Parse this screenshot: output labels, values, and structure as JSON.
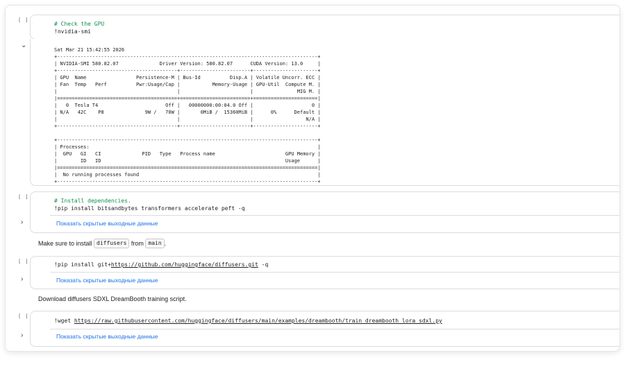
{
  "cells": [
    {
      "run_indicator": "[ ]",
      "comment": "# Check the GPU",
      "code": "!nvidia-smi"
    },
    {
      "run_indicator": "[ ]",
      "comment": "# Install dependencies.",
      "code": "!pip install bitsandbytes transformers accelerate peft -q",
      "output_link": "Показать скрытые выходные данные"
    },
    {
      "run_indicator": "[ ]",
      "code_prefix": "!pip install git+",
      "code_url": "https://github.com/huggingface/diffusers.git",
      "code_suffix": " -q",
      "output_link": "Показать скрытые выходные данные"
    },
    {
      "run_indicator": "[ ]",
      "code_prefix": "!wget ",
      "code_url": "https://raw.githubusercontent.com/huggingface/diffusers/main/examples/dreambooth/train_dreambooth_lora_sdxl.py",
      "output_link": "Показать скрытые выходные данные"
    }
  ],
  "nvidia_smi_output": "Sat Mar 21 15:42:55 2026\n+-----------------------------------------------------------------------------------------+\n| NVIDIA-SMI 580.82.07              Driver Version: 580.82.07      CUDA Version: 13.0     |\n+-----------------------------------------+------------------------+----------------------+\n| GPU  Name                 Persistence-M | Bus-Id          Disp.A | Volatile Uncorr. ECC |\n| Fan  Temp   Perf          Pwr:Usage/Cap |           Memory-Usage | GPU-Util  Compute M. |\n|                                         |                        |               MIG M. |\n|=========================================+========================+======================|\n|   0  Tesla T4                       Off |   00000000:00:04.0 Off |                    0 |\n| N/A   42C    P8              9W /   70W |       0MiB /  15360MiB |      0%      Default |\n|                                         |                        |                  N/A |\n+-----------------------------------------+------------------------+----------------------+\n\n+-----------------------------------------------------------------------------------------+\n| Processes:                                                                              |\n|  GPU   GI   CI              PID   Type   Process name                        GPU Memory |\n|        ID   ID                                                               Usage      |\n|=========================================================================================|\n|  No running processes found                                                             |\n+-----------------------------------------------------------------------------------------+",
  "markdown1": {
    "before": "Make sure to install ",
    "chip1": "diffusers",
    "mid": " from ",
    "chip2": "main",
    "after": "."
  },
  "markdown2": "Download diffusers SDXL DreamBooth training script.",
  "icons": {
    "chevron_down": "⌄",
    "chevron_right": "›"
  }
}
